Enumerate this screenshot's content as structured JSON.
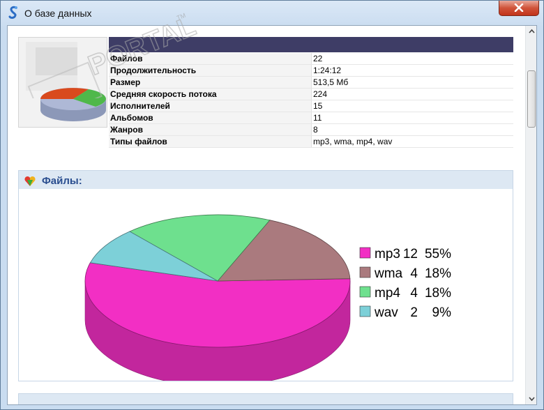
{
  "window": {
    "title": "О базе данных"
  },
  "properties": [
    {
      "label": "Файлов",
      "value": "22"
    },
    {
      "label": "Продолжительность",
      "value": "1:24:12"
    },
    {
      "label": "Размер",
      "value": "513,5 Мб"
    },
    {
      "label": "Средняя скорость потока",
      "value": "224"
    },
    {
      "label": "Исполнителей",
      "value": "15"
    },
    {
      "label": "Альбомов",
      "value": "11"
    },
    {
      "label": "Жанров",
      "value": "8"
    },
    {
      "label": "Типы файлов",
      "value": "mp3, wma, mp4, wav"
    }
  ],
  "files_section": {
    "title": "Файлы:"
  },
  "watermark": {
    "text": "PORTAL",
    "tm": "TM"
  },
  "chart_data": {
    "type": "pie",
    "title": "",
    "slices": [
      {
        "label": "mp3",
        "count": 12,
        "percent": "55%",
        "value": 55,
        "color": "#f22fc4"
      },
      {
        "label": "wma",
        "count": 4,
        "percent": "18%",
        "value": 18,
        "color": "#aa7a7e"
      },
      {
        "label": "mp4",
        "count": 4,
        "percent": "18%",
        "value": 18,
        "color": "#6ee08e"
      },
      {
        "label": "wav",
        "count": 2,
        "percent": "9%",
        "value": 9,
        "color": "#7dd0d8"
      }
    ],
    "legend_position": "right"
  },
  "colors": {
    "accent": "#3e3d66",
    "section_title": "#2a4e8f",
    "close_button": "#c94a33"
  }
}
